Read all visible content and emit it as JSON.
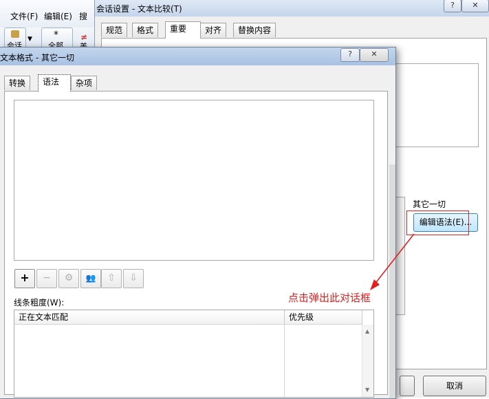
{
  "app": {
    "menu": [
      "文件(F)",
      "编辑(E)",
      "搜"
    ],
    "ribbon": {
      "session_label": "会话",
      "all_label": "全部",
      "extra_label": "美"
    }
  },
  "bg_dialog": {
    "title": "会话设置 - 文本比较(T)",
    "help_btn": "?",
    "close_btn": "✕",
    "tabs": [
      "规范",
      "格式",
      "重要",
      "对齐",
      "替换内容"
    ],
    "selected_tab": "重要",
    "section_label": "其它一切",
    "edit_grammar_button": "编辑语法(E)...",
    "cancel_button": "取消"
  },
  "fg_dialog": {
    "title": "文本格式 - 其它一切",
    "help_btn": "?",
    "close_btn": "✕",
    "tabs": [
      "转换",
      "语法",
      "杂项"
    ],
    "selected_tab": "语法",
    "toolbar": {
      "add": "+",
      "remove": "−",
      "settings": "⚙",
      "group": "👥",
      "up": "⇧",
      "down": "⇩"
    },
    "line_label": "线条粗度(W):",
    "table_headers": [
      "正在文本匹配",
      "优先级"
    ]
  },
  "annotation": {
    "text": "点击弹出此对话框",
    "color": "#e02020"
  }
}
